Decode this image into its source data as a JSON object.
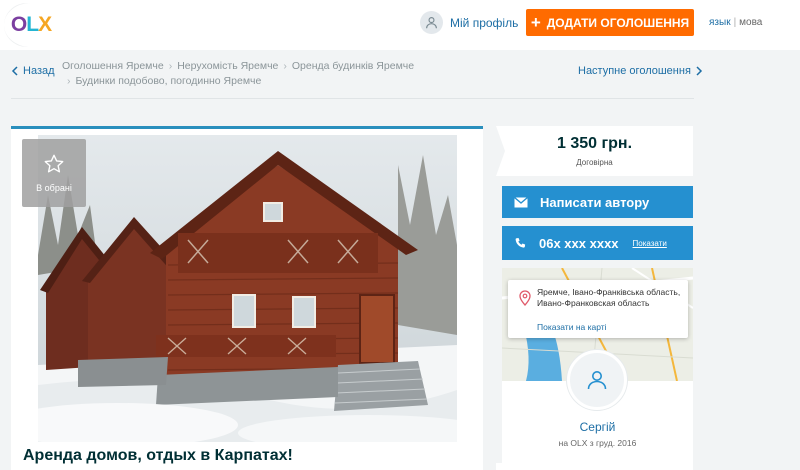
{
  "header": {
    "logo": {
      "o": "O",
      "l": "L",
      "x": "X"
    },
    "profile_label": "Мій профіль",
    "add_button_label": "ДОДАТИ ОГОЛОШЕННЯ",
    "lang_active": "язык",
    "lang_current": "мова"
  },
  "nav": {
    "back_label": "Назад",
    "next_label": "Наступне оголошення",
    "breadcrumbs": [
      "Оголошення Яремче",
      "Нерухомість Яремче",
      "Оренда будинків Яремче",
      "Будинки подобово, погодинно Яремче"
    ]
  },
  "listing": {
    "favorite_label": "В обрані",
    "title": "Аренда домов, отдых в Карпатах!",
    "price": "1 350 грн.",
    "price_note": "Договірна"
  },
  "contact": {
    "write_label": "Написати автору",
    "phone_masked": "06x xxx xxxx",
    "show_label": "Показати"
  },
  "location": {
    "address": "Яремче, Івано-Франківська область, Ивано-Франковская область",
    "map_link": "Показати на карті"
  },
  "seller": {
    "name": "Сергій",
    "since": "на OLX з груд. 2016"
  },
  "colors": {
    "accent": "#2590d0",
    "cta": "#ff6b00",
    "link": "#1d6ea5"
  }
}
